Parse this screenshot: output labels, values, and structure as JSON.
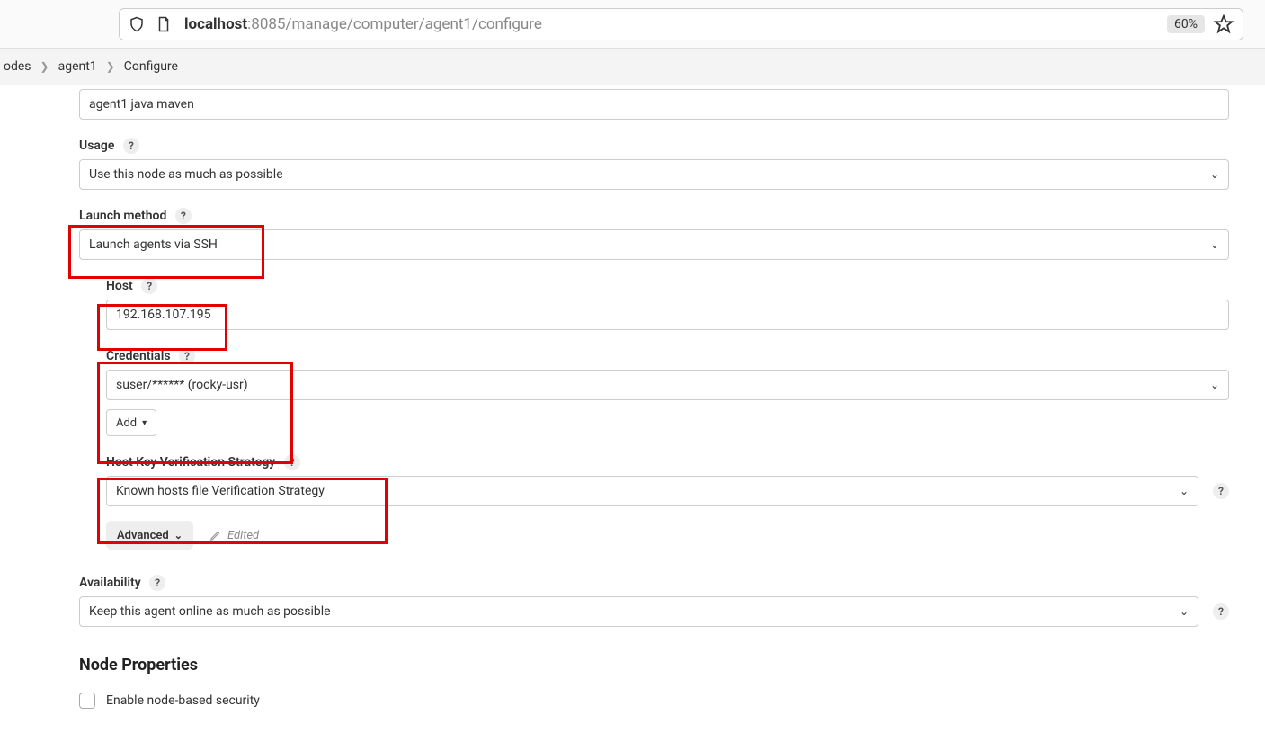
{
  "browser": {
    "url_dim_prefix": "localhost",
    "url_suffix": ":8085/manage/computer/agent1/configure",
    "zoom": "60%"
  },
  "breadcrumb": {
    "items": [
      "odes",
      "agent1",
      "Configure"
    ]
  },
  "form": {
    "topInputValue": "agent1 java maven",
    "usage": {
      "label": "Usage",
      "value": "Use this node as much as possible"
    },
    "launch": {
      "label": "Launch method",
      "value": "Launch agents via SSH"
    },
    "host": {
      "label": "Host",
      "value": "192.168.107.195"
    },
    "credentials": {
      "label": "Credentials",
      "value": "suser/****** (rocky-usr)",
      "addLabel": "Add"
    },
    "hostKey": {
      "label": "Host Key Verification Strategy",
      "value": "Known hosts file Verification Strategy"
    },
    "advanced": {
      "label": "Advanced",
      "editedLabel": "Edited"
    },
    "availability": {
      "label": "Availability",
      "value": "Keep this agent online as much as possible"
    },
    "nodeProps": {
      "title": "Node Properties",
      "checkbox1": "Enable node-based security"
    }
  }
}
